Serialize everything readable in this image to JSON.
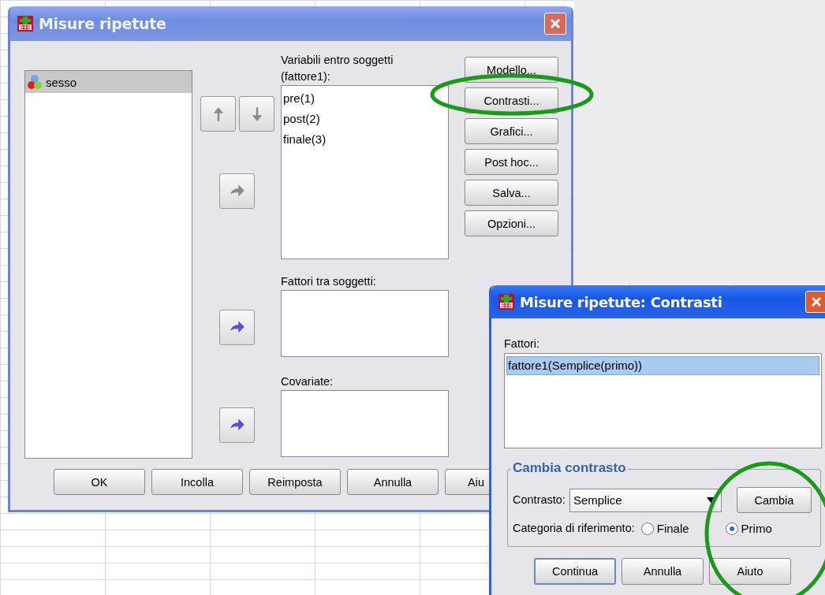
{
  "main_dialog": {
    "title": "Misure ripetute",
    "source_list": [
      {
        "label": "sesso",
        "selected": true
      }
    ],
    "order_buttons": [
      {
        "kind": "up",
        "disabled": true
      },
      {
        "kind": "down",
        "disabled": true
      }
    ],
    "within_label": "Variabili entro soggetti (fattore1):",
    "within_items": [
      "pre(1)",
      "post(2)",
      "finale(3)"
    ],
    "between_label": "Fattori tra soggetti:",
    "covariates_label": "Covariate:",
    "transfer_buttons": [
      {
        "disabled": true
      },
      {
        "disabled": false
      },
      {
        "disabled": false
      }
    ],
    "side_buttons": [
      {
        "label": "Modello..."
      },
      {
        "label": "Contrasti..."
      },
      {
        "label": "Grafici..."
      },
      {
        "label": "Post hoc..."
      },
      {
        "label": "Salva..."
      },
      {
        "label": "Opzioni..."
      }
    ],
    "bottom_buttons": [
      {
        "label": "OK"
      },
      {
        "label": "Incolla"
      },
      {
        "label": "Reimposta"
      },
      {
        "label": "Annulla"
      },
      {
        "label": "Aiu"
      }
    ]
  },
  "contrasts_dialog": {
    "title": "Misure ripetute: Contrasti",
    "factors_label": "Fattori:",
    "factors": [
      {
        "label": "fattore1(Semplice(primo))",
        "selected": true
      }
    ],
    "group_title": "Cambia contrasto",
    "contrast_label": "Contrasto:",
    "contrast_value": "Semplice",
    "change_button": "Cambia",
    "reference_label": "Categoria di riferimento:",
    "reference_options": [
      {
        "label": "Finale",
        "selected": false
      },
      {
        "label": "Primo",
        "selected": true
      }
    ],
    "buttons": [
      {
        "label": "Continua",
        "default": true
      },
      {
        "label": "Annulla",
        "default": false
      },
      {
        "label": "Aiuto",
        "default": false
      }
    ]
  }
}
